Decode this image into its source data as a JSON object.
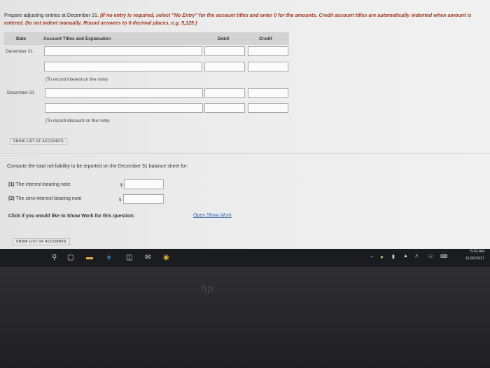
{
  "instructions": {
    "plain": "Prepare adjusting entries at December 31. ",
    "bold": "(If no entry is required, select \"No Entry\" for the account titles and enter 0 for the amounts. Credit account titles are automatically indented when amount is entered. Do not indent manually. Round answers to 0 decimal places, e.g. 5,125.)"
  },
  "table": {
    "headers": {
      "date": "Date",
      "account": "Account Titles and Explanation",
      "debit": "Debit",
      "credit": "Credit"
    },
    "entries": [
      {
        "date": "December 31",
        "memo": "(To record interest on the note)"
      },
      {
        "date": "December 31",
        "memo": "(To record discount on the note)"
      }
    ]
  },
  "show_accounts_label": "SHOW LIST OF ACCOUNTS",
  "compute": {
    "prompt": "Compute the total net liability to be reported on the December 31 balance sheet for:",
    "items": [
      {
        "num": "(1)",
        "label": "The interest-bearing note",
        "currency": "$"
      },
      {
        "num": "(2)",
        "label": "The zero-interest-bearing note",
        "currency": "$"
      }
    ],
    "show_work_prompt": "Click if you would like to Show Work for this question:",
    "show_work_link": "Open Show Work"
  },
  "taskbar": {
    "time": "5:30 AM",
    "date": "11/30/2017",
    "icons": [
      "search-icon",
      "task-view-icon",
      "file-explorer-icon",
      "edge-icon",
      "store-icon",
      "mail-icon",
      "chrome-icon"
    ]
  }
}
